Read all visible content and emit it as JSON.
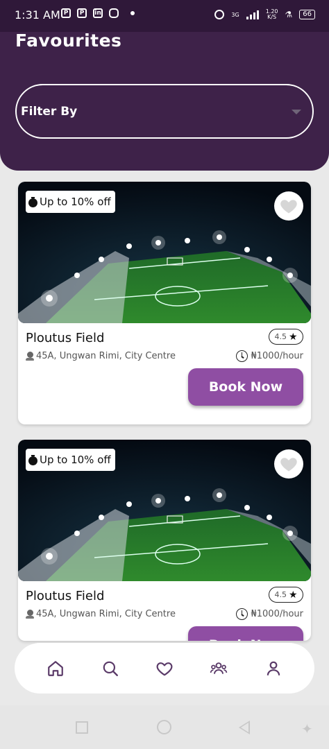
{
  "status_bar": {
    "time": "1:31 AM",
    "network": "3G",
    "speed": "1.20",
    "speed_unit": "K/S",
    "battery": "66"
  },
  "header": {
    "title": "Favourites",
    "filter_label": "Filter By"
  },
  "cards": [
    {
      "discount": "Up to 10% off",
      "name": "Ploutus Field",
      "rating": "4.5",
      "address": "45A, Ungwan Rimi, City Centre",
      "price": "₦1000/hour",
      "book_label": "Book Now"
    },
    {
      "discount": "Up to 10% off",
      "name": "Ploutus Field",
      "rating": "4.5",
      "address": "45A, Ungwan Rimi, City Centre",
      "price": "₦1000/hour",
      "book_label": "Book Now"
    }
  ],
  "bottom_nav": {
    "items": [
      "home-icon",
      "search-icon",
      "heart-icon",
      "community-icon",
      "profile-icon"
    ],
    "active_color": "#3e2249"
  },
  "colors": {
    "header": "#3e2249",
    "accent": "#8f4ea3",
    "background": "#e9e9e9"
  }
}
